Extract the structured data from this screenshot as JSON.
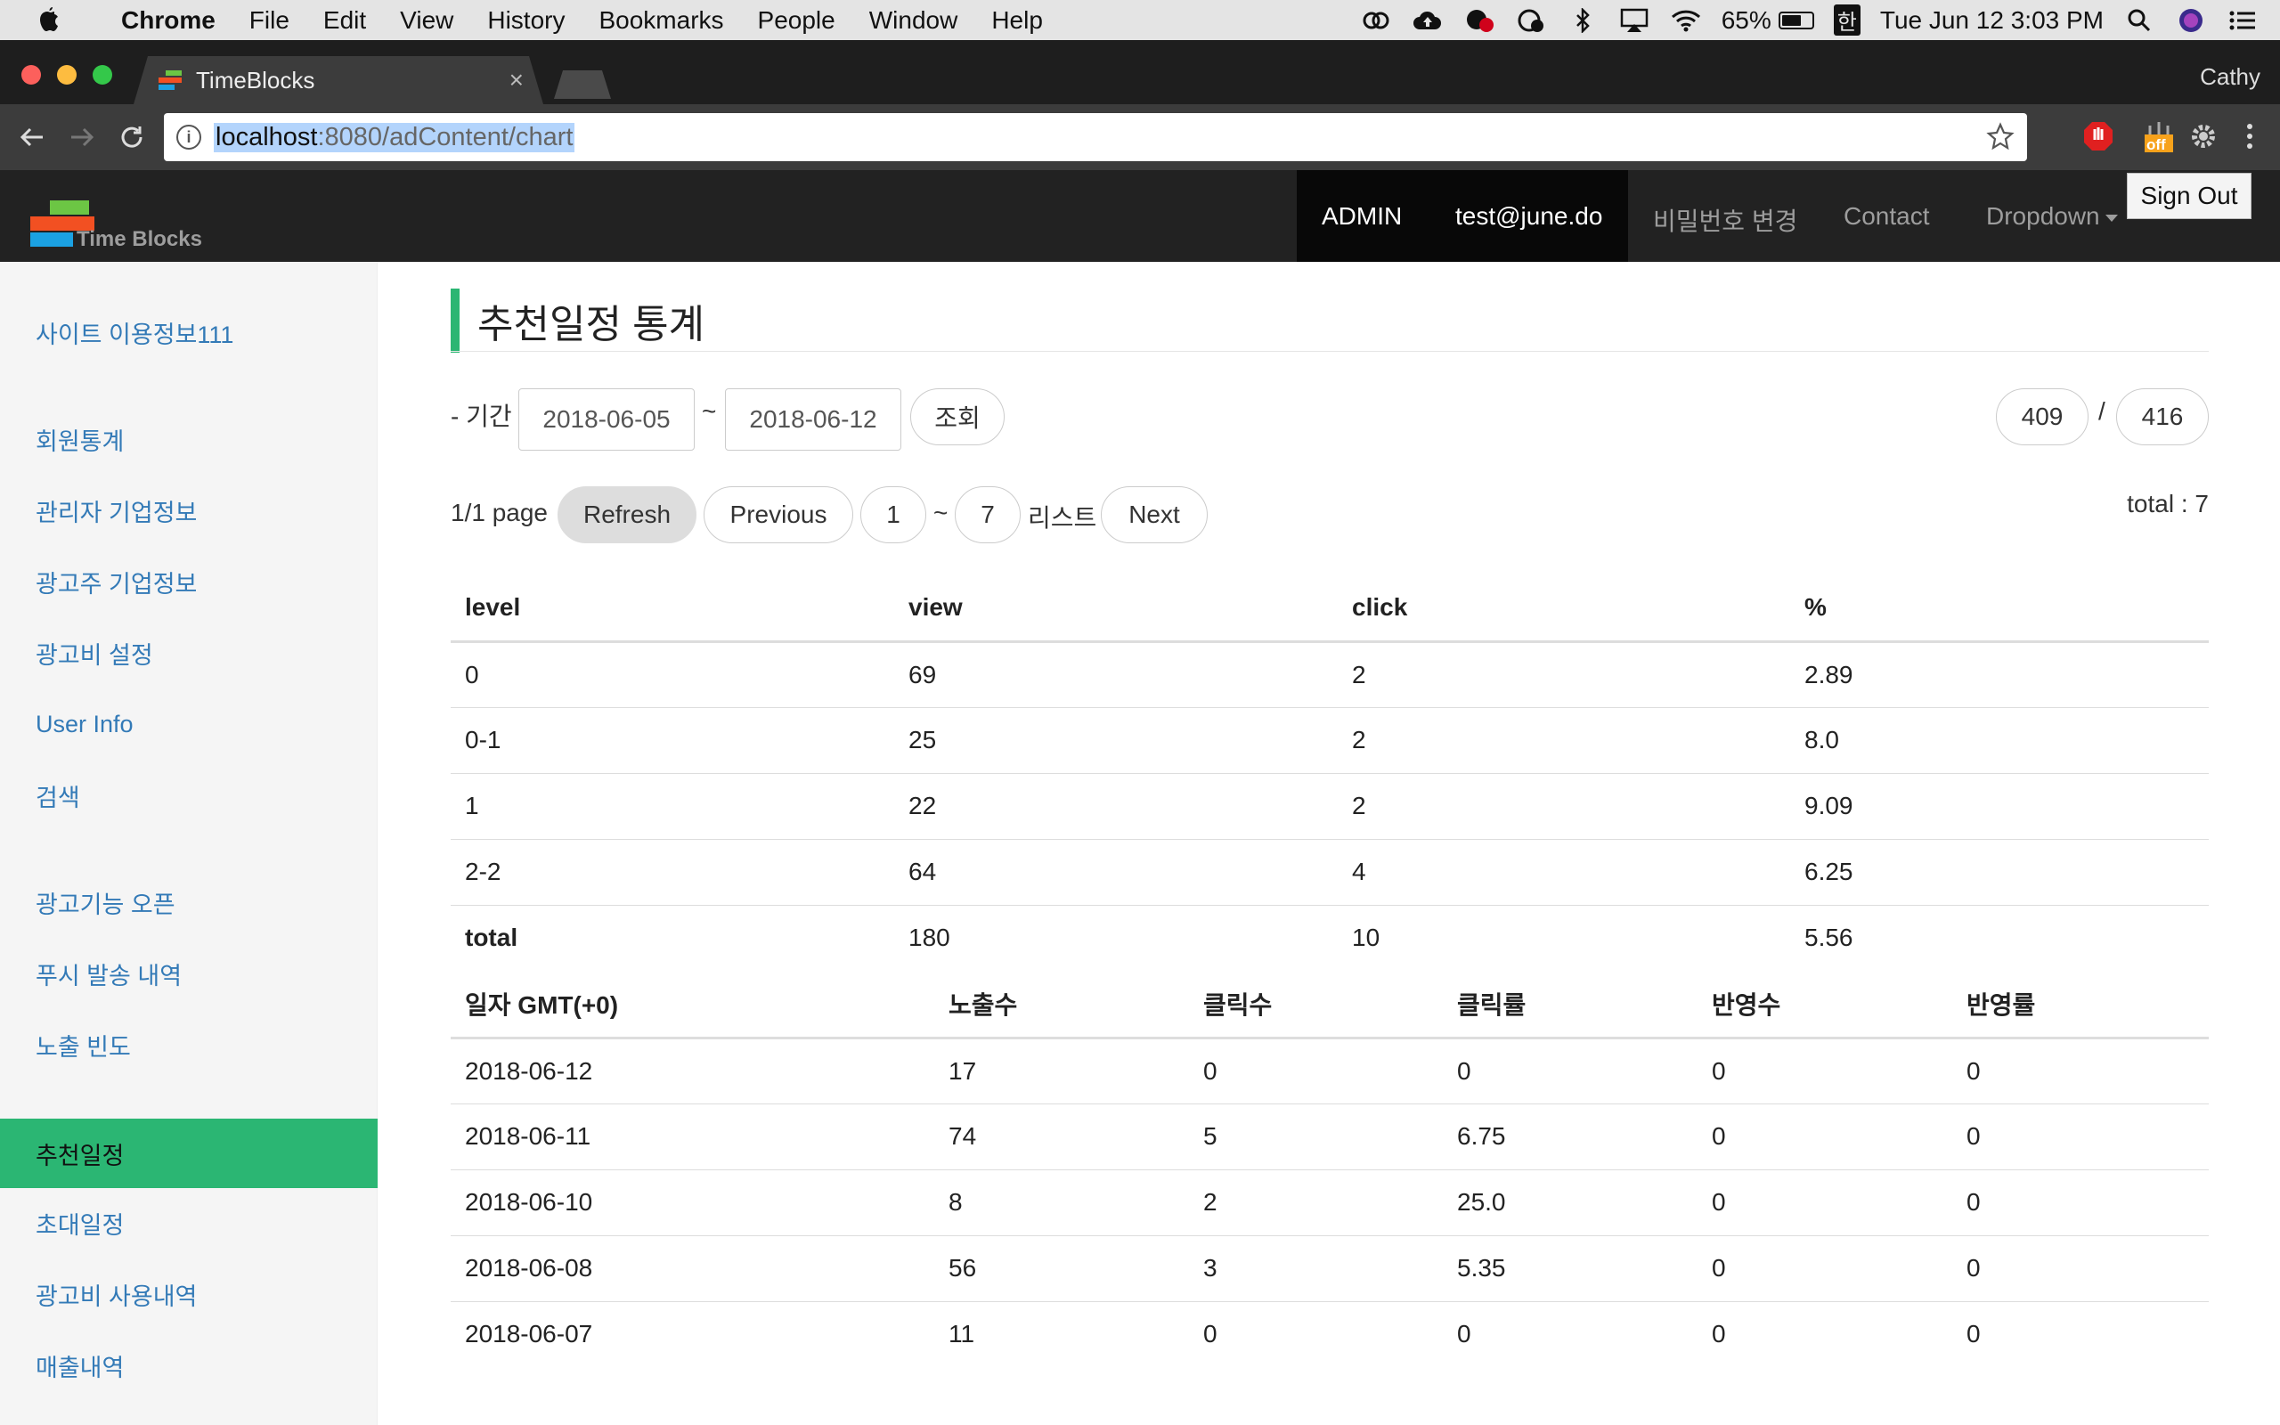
{
  "mac": {
    "app": "Chrome",
    "menus": [
      "File",
      "Edit",
      "View",
      "History",
      "Bookmarks",
      "People",
      "Window",
      "Help"
    ],
    "battery": "65%",
    "battery_level": 0.65,
    "input_lang": "한",
    "datetime": "Tue Jun 12  3:03 PM"
  },
  "browser": {
    "tab_title": "TimeBlocks",
    "profile": "Cathy",
    "url_host": "localhost",
    "url_path": ":8080/adContent/chart",
    "ext_badge": "off"
  },
  "navbar": {
    "brand": "Time Blocks",
    "items": [
      "ADMIN",
      "test@june.do",
      "비밀번호 변경",
      "Contact",
      "Dropdown"
    ],
    "signout": "Sign Out"
  },
  "sidebar": {
    "items": [
      "사이트 이용정보111",
      "회원통계",
      "관리자 기업정보",
      "광고주 기업정보",
      "광고비 설정",
      "User Info",
      "검색",
      "광고기능 오픈",
      "푸시 발송 내역",
      "노출 빈도",
      "추천일정",
      "초대일정",
      "광고비 사용내역",
      "매출내역"
    ],
    "active_index": 10
  },
  "main": {
    "title": "추천일정 통계",
    "period_label": "- 기간",
    "date_from": "2018-06-05",
    "tilde": "~",
    "date_to": "2018-06-12",
    "search_button": "조회",
    "count_a": "409",
    "slash": "/",
    "count_b": "416",
    "page_info": "1/1 page",
    "refresh": "Refresh",
    "previous": "Previous",
    "range_from": "1",
    "range_to": "7",
    "list_label": "리스트",
    "next": "Next",
    "total": "total : 7"
  },
  "level_table": {
    "headers": [
      "level",
      "view",
      "click",
      "%"
    ],
    "rows": [
      [
        "0",
        "69",
        "2",
        "2.89"
      ],
      [
        "0-1",
        "25",
        "2",
        "8.0"
      ],
      [
        "1",
        "22",
        "2",
        "9.09"
      ],
      [
        "2-2",
        "64",
        "4",
        "6.25"
      ],
      [
        "total",
        "180",
        "10",
        "5.56"
      ]
    ]
  },
  "daily_table": {
    "headers": [
      "일자 GMT(+0)",
      "노출수",
      "클릭수",
      "클릭률",
      "반영수",
      "반영률"
    ],
    "rows": [
      [
        "2018-06-12",
        "17",
        "0",
        "0",
        "0",
        "0"
      ],
      [
        "2018-06-11",
        "74",
        "5",
        "6.75",
        "0",
        "0"
      ],
      [
        "2018-06-10",
        "8",
        "2",
        "25.0",
        "0",
        "0"
      ],
      [
        "2018-06-08",
        "56",
        "3",
        "5.35",
        "0",
        "0"
      ],
      [
        "2018-06-07",
        "11",
        "0",
        "0",
        "0",
        "0"
      ]
    ]
  },
  "colors": {
    "accent": "#2bb673",
    "link": "#337ab7",
    "navbar": "#222222"
  }
}
